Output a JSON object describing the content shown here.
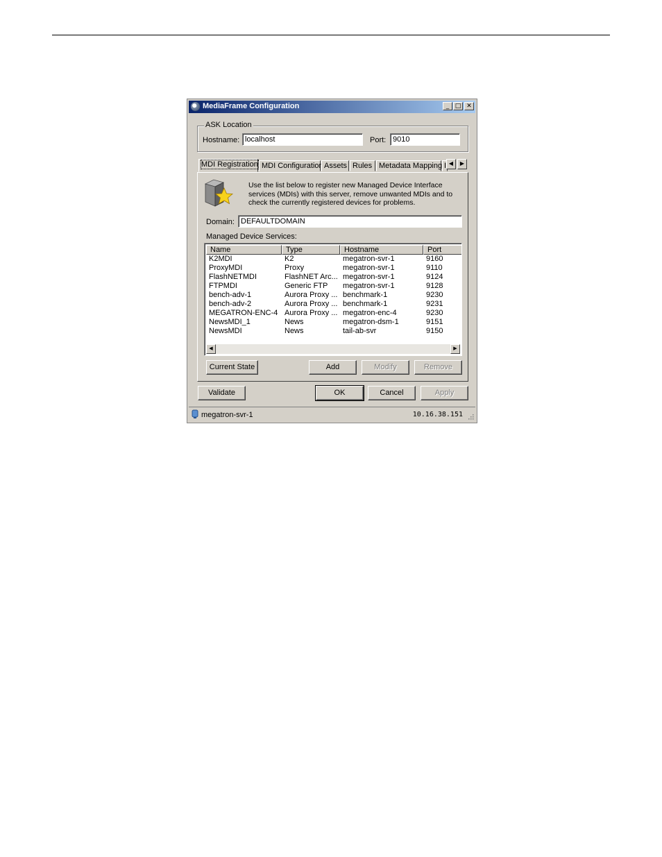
{
  "window": {
    "title": "MediaFrame Configuration"
  },
  "titlebar_buttons": {
    "minimize": "_",
    "maximize": "□",
    "close": "✕"
  },
  "ask_location": {
    "legend": "ASK Location",
    "hostname_label": "Hostname:",
    "hostname_value": "localhost",
    "port_label": "Port:",
    "port_value": "9010"
  },
  "tabs": [
    "MDI Registration",
    "MDI Configuration",
    "Assets",
    "Rules",
    "Metadata Mapping",
    "I"
  ],
  "tab_scroll": {
    "left": "◀",
    "right": "▶"
  },
  "mdi_registration": {
    "description": "Use the list below to register new Managed Device Interface services (MDIs) with this server, remove unwanted MDIs and to check the currently registered devices for problems.",
    "domain_label": "Domain:",
    "domain_value": "DEFAULTDOMAIN",
    "services_label": "Managed Device Services:",
    "columns": [
      "Name",
      "Type",
      "Hostname",
      "Port"
    ],
    "rows": [
      [
        "K2MDI",
        "K2",
        "megatron-svr-1",
        "9160"
      ],
      [
        "ProxyMDI",
        "Proxy",
        "megatron-svr-1",
        "9110"
      ],
      [
        "FlashNETMDI",
        "FlashNET Arc...",
        "megatron-svr-1",
        "9124"
      ],
      [
        "FTPMDI",
        "Generic FTP",
        "megatron-svr-1",
        "9128"
      ],
      [
        "bench-adv-1",
        "Aurora Proxy ...",
        "benchmark-1",
        "9230"
      ],
      [
        "bench-adv-2",
        "Aurora Proxy ...",
        "benchmark-1",
        "9231"
      ],
      [
        "MEGATRON-ENC-4",
        "Aurora Proxy ...",
        "megatron-enc-4",
        "9230"
      ],
      [
        "NewsMDI_1",
        "News",
        "megatron-dsm-1",
        "9151"
      ],
      [
        "NewsMDI",
        "News",
        "tail-ab-svr",
        "9150"
      ]
    ],
    "buttons": {
      "current_state": "Current State",
      "add": "Add",
      "modify": "Modify",
      "remove": "Remove"
    }
  },
  "dialog_buttons": {
    "validate": "Validate",
    "ok": "OK",
    "cancel": "Cancel",
    "apply": "Apply"
  },
  "statusbar": {
    "server": "megatron-svr-1",
    "ip": "10.16.38.151"
  }
}
